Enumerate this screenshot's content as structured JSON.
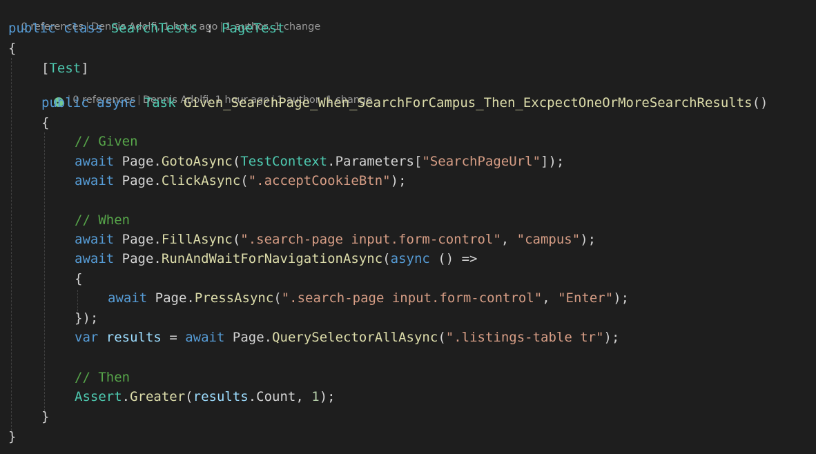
{
  "codelens_class": {
    "references": "0 references",
    "author_time": "Dennis Adolfi, 1 hour ago",
    "changes": "1 author, 1 change"
  },
  "codelens_method": {
    "status_icon": "check-circle-icon",
    "references": "0 references",
    "author_time": "Dennis Adolfi, 1 hour ago",
    "changes": "1 author, 1 change"
  },
  "code": {
    "class_decl": {
      "kw1": "public",
      "kw2": "class",
      "name": "SearchTests",
      "colon": ":",
      "base": "PageTest"
    },
    "brace_open": "{",
    "attribute": {
      "open": "[",
      "name": "Test",
      "close": "]"
    },
    "method_decl": {
      "kw1": "public",
      "kw2": "async",
      "ret": "Task",
      "name": "Given_SearchPage_When_SearchForCampus_Then_ExcpectOneOrMoreSearchResults",
      "parens": "()"
    },
    "method_brace_open": "{",
    "comment_given": "// Given",
    "goto": {
      "await": "await",
      "obj": "Page",
      "method": "GotoAsync",
      "ctx": "TestContext",
      "prop": "Parameters",
      "key": "\"SearchPageUrl\"",
      "tail": "]);"
    },
    "click": {
      "await": "await",
      "obj": "Page",
      "method": "ClickAsync",
      "arg": "\".acceptCookieBtn\"",
      "tail": ");"
    },
    "comment_when": "// When",
    "fill": {
      "await": "await",
      "obj": "Page",
      "method": "FillAsync",
      "arg1": "\".search-page input.form-control\"",
      "arg2": "\"campus\"",
      "tail": ");"
    },
    "run": {
      "await": "await",
      "obj": "Page",
      "method": "RunAndWaitForNavigationAsync",
      "async": "async",
      "lambda": "() =>"
    },
    "lambda_open": "{",
    "press": {
      "await": "await",
      "obj": "Page",
      "method": "PressAsync",
      "arg1": "\".search-page input.form-control\"",
      "arg2": "\"Enter\"",
      "tail": ");"
    },
    "lambda_close": "});",
    "results": {
      "kw": "var",
      "name": "results",
      "eq": "=",
      "await": "await",
      "obj": "Page",
      "method": "QuerySelectorAllAsync",
      "arg": "\".listings-table tr\"",
      "tail": ");"
    },
    "comment_then": "// Then",
    "assert": {
      "cls": "Assert",
      "method": "Greater",
      "arg1_obj": "results",
      "arg1_prop": "Count",
      "arg2": "1",
      "tail": ");"
    },
    "method_brace_close": "}",
    "brace_close": "}"
  }
}
